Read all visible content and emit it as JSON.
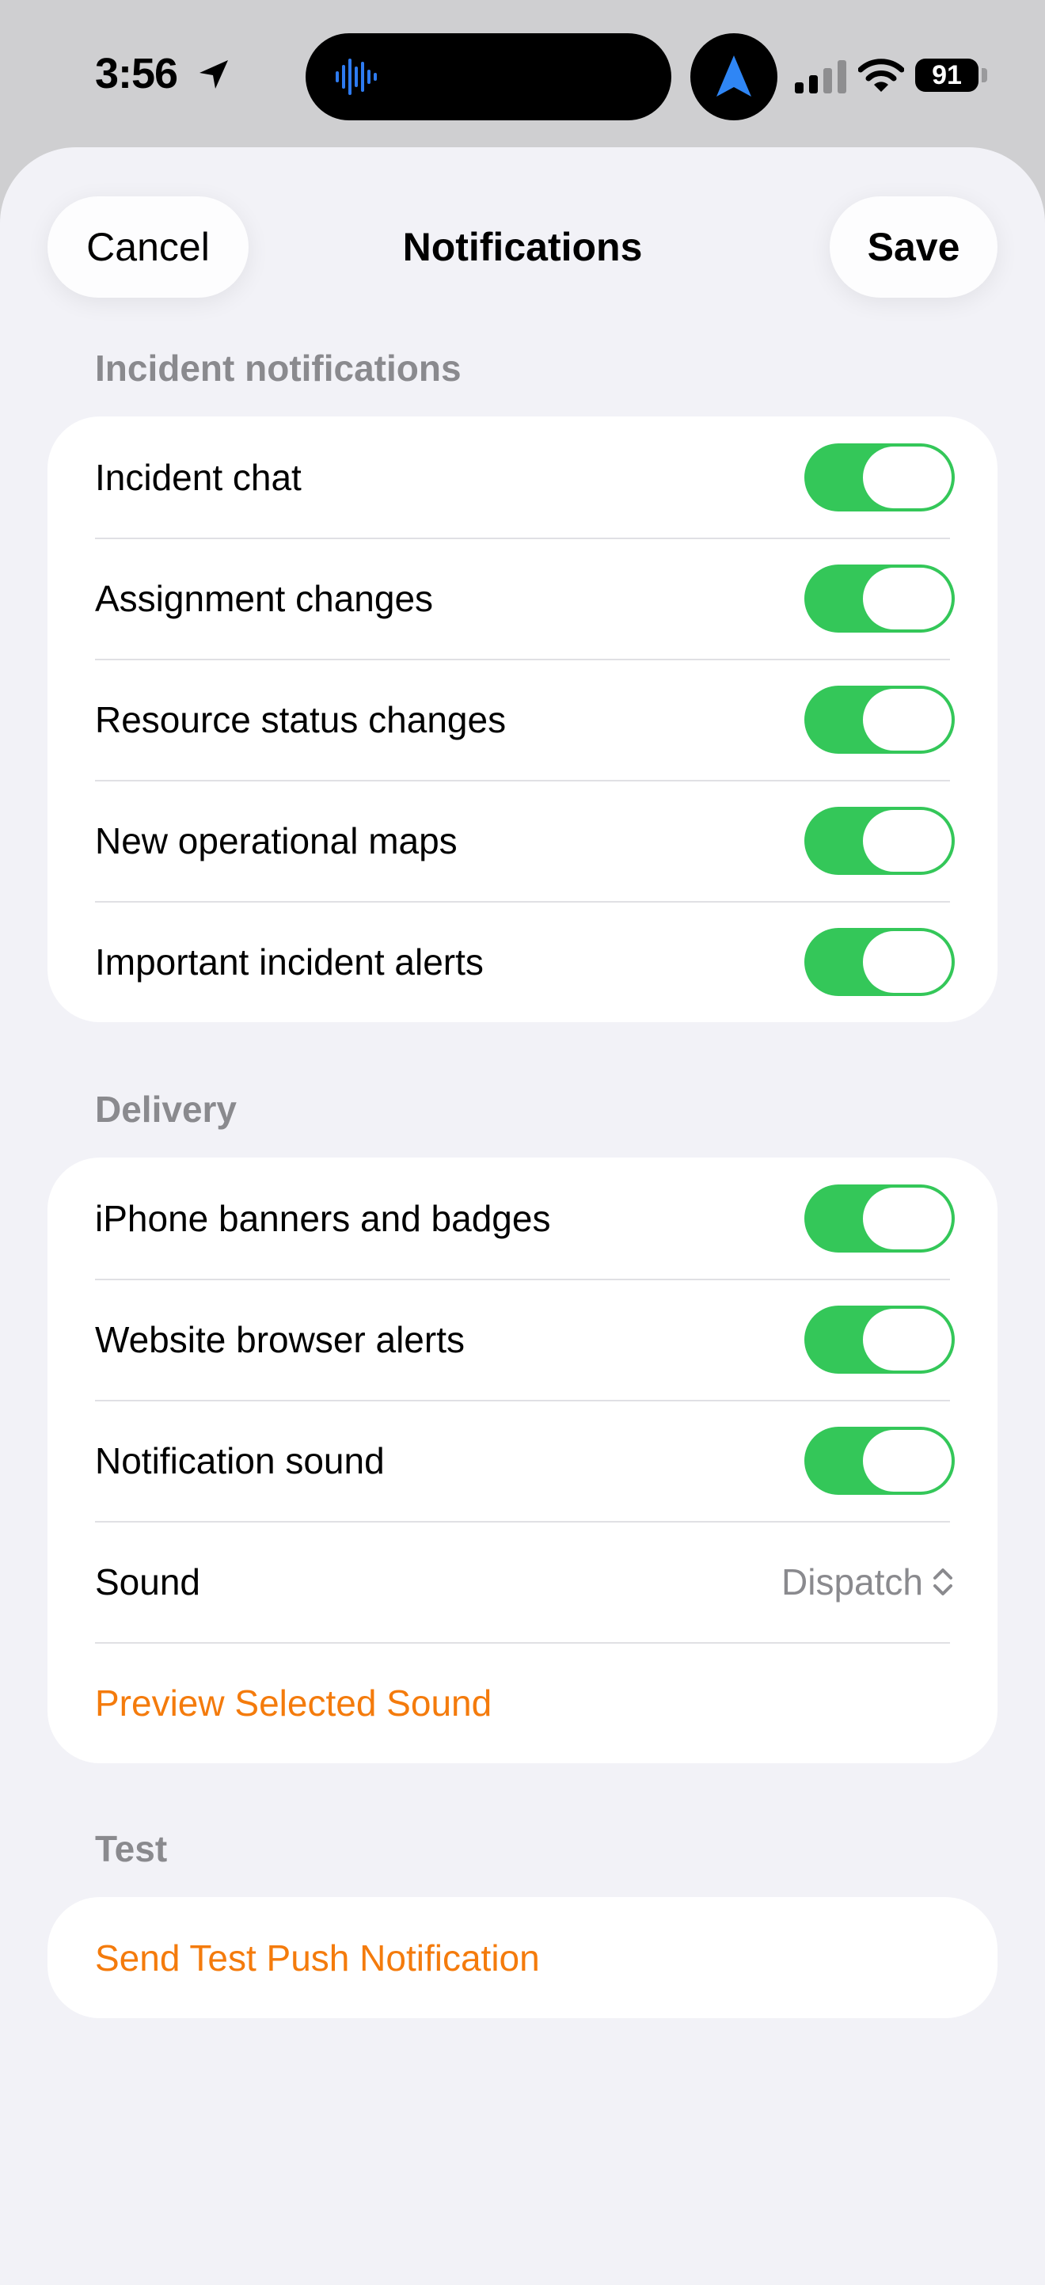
{
  "status_bar": {
    "time": "3:56",
    "battery": "91",
    "icons": [
      "location-arrow-icon",
      "audio-wave-icon",
      "navigation-icon",
      "signal-icon",
      "wifi-icon",
      "battery-icon"
    ]
  },
  "header": {
    "cancel_label": "Cancel",
    "title": "Notifications",
    "save_label": "Save"
  },
  "sections": {
    "incident": {
      "header": "Incident notifications",
      "rows": [
        {
          "label": "Incident chat",
          "on": true
        },
        {
          "label": "Assignment changes",
          "on": true
        },
        {
          "label": "Resource status changes",
          "on": true
        },
        {
          "label": "New operational maps",
          "on": true
        },
        {
          "label": "Important incident alerts",
          "on": true
        }
      ]
    },
    "delivery": {
      "header": "Delivery",
      "rows": [
        {
          "label": "iPhone banners and badges",
          "on": true
        },
        {
          "label": "Website browser alerts",
          "on": true
        },
        {
          "label": "Notification sound",
          "on": true
        }
      ],
      "sound_label": "Sound",
      "sound_value": "Dispatch",
      "preview_label": "Preview Selected Sound"
    },
    "test": {
      "header": "Test",
      "action_label": "Send Test Push Notification"
    }
  },
  "colors": {
    "toggle_on": "#34c759",
    "accent_orange": "#f47b0c",
    "background": "#f2f2f7",
    "secondary_text": "#8a8a8e"
  }
}
